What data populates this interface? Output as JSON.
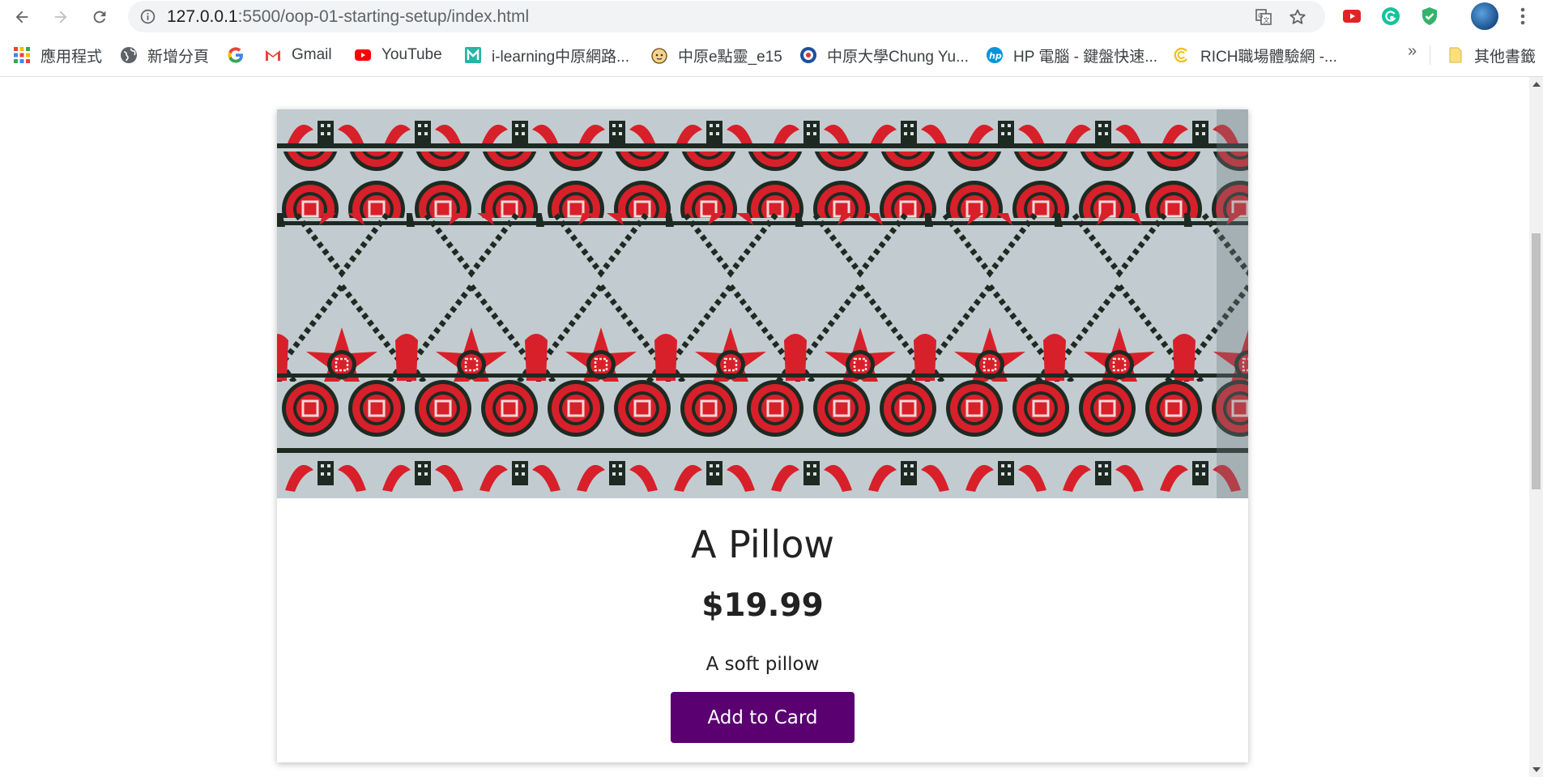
{
  "browser": {
    "url_host": "127.0.0.1",
    "url_rest": ":5500/oop-01-starting-setup/index.html"
  },
  "bookmarks": {
    "items": [
      {
        "label": "應用程式",
        "icon": "apps-grid-icon"
      },
      {
        "label": "新增分頁",
        "icon": "globe-icon"
      },
      {
        "label": "",
        "icon": "google-icon"
      },
      {
        "label": "Gmail",
        "icon": "gmail-icon"
      },
      {
        "label": "YouTube",
        "icon": "youtube-icon"
      },
      {
        "label": "i-learning中原網路...",
        "icon": "ilearning-icon"
      },
      {
        "label": "中原e點靈_e15",
        "icon": "face-icon"
      },
      {
        "label": "中原大學Chung Yu...",
        "icon": "cycu-icon"
      },
      {
        "label": "HP 電腦 - 鍵盤快速...",
        "icon": "hp-icon"
      },
      {
        "label": "RICH職場體驗網 -...",
        "icon": "rich-icon"
      }
    ],
    "more": "»",
    "other_folder": "其他書籤"
  },
  "product": {
    "title": "A Pillow",
    "price": "$19.99",
    "description": "A soft pillow",
    "button_label": "Add to Card"
  },
  "colors": {
    "button_bg": "#5a0070",
    "embroidery_red": "#d8202a",
    "embroidery_dark": "#1d2a22",
    "fabric": "#c2ccd0"
  }
}
